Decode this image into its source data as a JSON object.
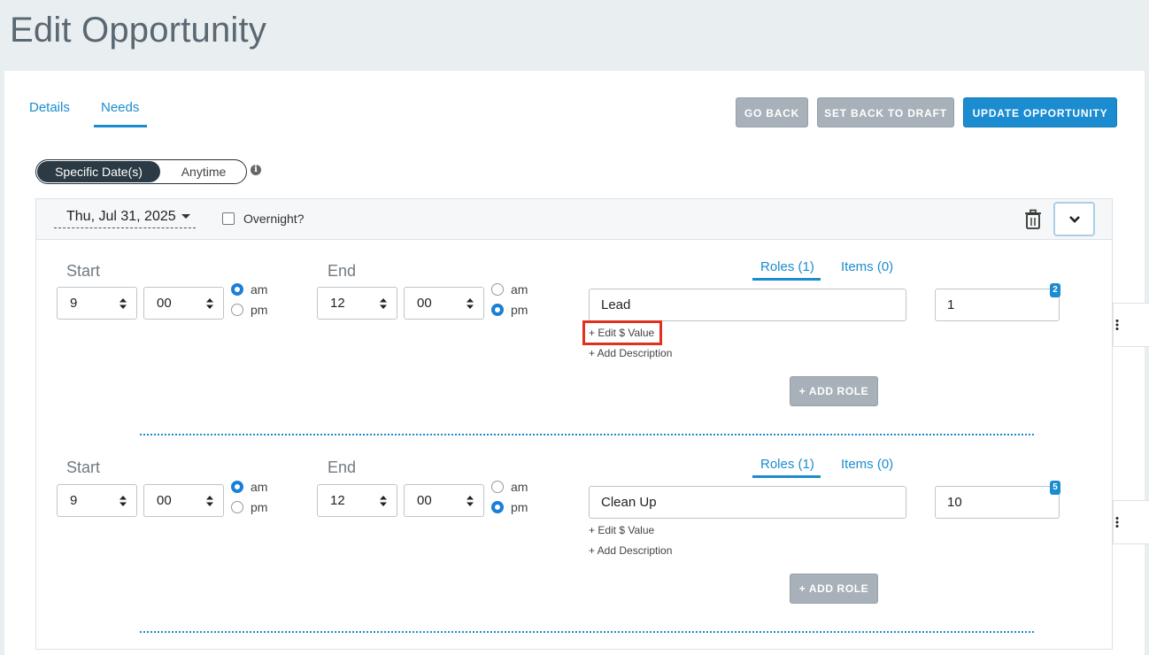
{
  "page": {
    "title": "Edit Opportunity"
  },
  "tabs": {
    "details": "Details",
    "needs": "Needs"
  },
  "actions": {
    "go_back": "GO BACK",
    "set_back_to_draft": "SET BACK TO DRAFT",
    "update_opportunity": "UPDATE OPPORTUNITY"
  },
  "schedule_toggle": {
    "specific": "Specific Date(s)",
    "anytime": "Anytime",
    "selected": "Specific Date(s)"
  },
  "date_block": {
    "date": "Thu, Jul 31, 2025",
    "overnight_label": "Overnight?",
    "overnight_checked": false
  },
  "shifts": [
    {
      "start_label": "Start",
      "end_label": "End",
      "start_hour": "9",
      "start_minute": "00",
      "start_meridiem": "am",
      "end_hour": "12",
      "end_minute": "00",
      "end_meridiem": "pm",
      "am_label": "am",
      "pm_label": "pm",
      "roles_tab": "Roles (1)",
      "items_tab": "Items (0)",
      "role_name": "Lead",
      "role_count": "1",
      "role_badge": "2",
      "edit_value_link": "+ Edit $ Value",
      "add_description_link": "+ Add Description",
      "add_role": "+ ADD ROLE"
    },
    {
      "start_label": "Start",
      "end_label": "End",
      "start_hour": "9",
      "start_minute": "00",
      "start_meridiem": "am",
      "end_hour": "12",
      "end_minute": "00",
      "end_meridiem": "pm",
      "am_label": "am",
      "pm_label": "pm",
      "roles_tab": "Roles (1)",
      "items_tab": "Items (0)",
      "role_name": "Clean Up",
      "role_count": "10",
      "role_badge": "5",
      "edit_value_link": "+ Edit $ Value",
      "add_description_link": "+ Add Description",
      "add_role": "+ ADD ROLE"
    }
  ],
  "icons": {
    "info": "info-icon",
    "trash": "trash-icon",
    "collapse": "chevron-down-icon",
    "menu": "kebab-menu-icon",
    "select": "up-down-caret-icon"
  },
  "colors": {
    "accent": "#1b8ccf",
    "disabled_button": "#a8b1b9",
    "toggle_active": "#2b3a44",
    "highlight": "#e0301e"
  }
}
